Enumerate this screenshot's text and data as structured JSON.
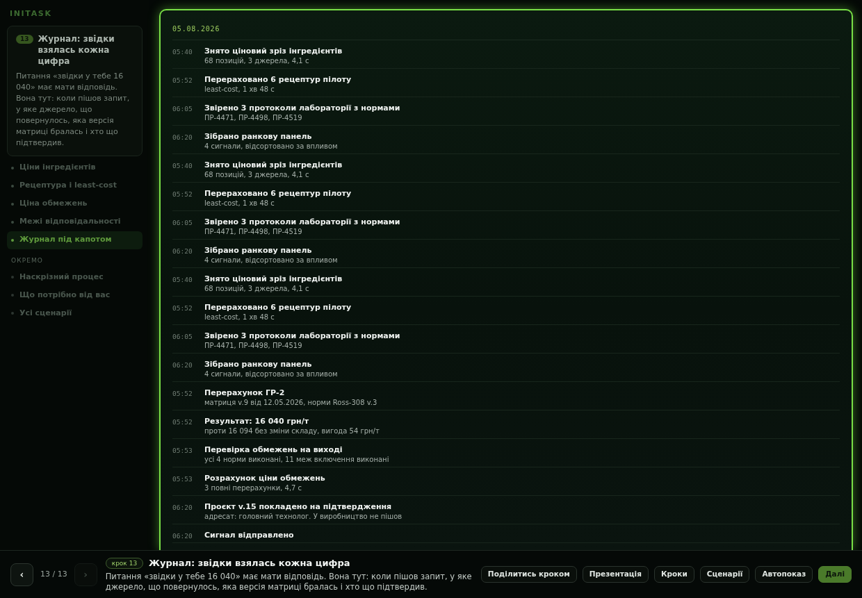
{
  "sidebar": {
    "logo": "INITASK",
    "items": [
      {
        "label": "Ціни інгредієнтів",
        "selected": false
      },
      {
        "label": "Рецептура і least-cost",
        "selected": false
      },
      {
        "label": "Ціна обмежень",
        "selected": false
      },
      {
        "label": "Межі відповідальності",
        "selected": false
      },
      {
        "label": "Журнал під капотом",
        "selected": true
      }
    ],
    "section": {
      "title": "ОКРЕМО",
      "items": [
        {
          "label": "Наскрізний процес",
          "selected": false
        },
        {
          "label": "Що потрібно від вас",
          "selected": false
        },
        {
          "label": "Усі сценарії",
          "selected": false
        }
      ]
    }
  },
  "step_card": {
    "badge": "13",
    "title": "Журнал: звідки взялась кожна цифра",
    "text": "Питання «звідки у тебе 16 040» має мати відповідь. Вона тут: коли пішов запит, у яке джерело, що повернулось, яка версія матриці бралась і хто що підтвердив."
  },
  "log": {
    "date": "05.08.2026",
    "entries": [
      {
        "time": "05:40",
        "title": "Знято ціновий зріз інгредієнтів",
        "detail": "68 позицій, 3 джерела, 4,1 с"
      },
      {
        "time": "05:52",
        "title": "Перераховано 6 рецептур пілоту",
        "detail": "least-cost, 1 хв 48 с"
      },
      {
        "time": "06:05",
        "title": "Звірено 3 протоколи лабораторії з нормами",
        "detail": "ПР-4471, ПР-4498, ПР-4519"
      },
      {
        "time": "06:20",
        "title": "Зібрано ранкову панель",
        "detail": "4 сигнали, відсортовано за впливом"
      },
      {
        "time": "05:40",
        "title": "Знято ціновий зріз інгредієнтів",
        "detail": "68 позицій, 3 джерела, 4,1 с"
      },
      {
        "time": "05:52",
        "title": "Перераховано 6 рецептур пілоту",
        "detail": "least-cost, 1 хв 48 с"
      },
      {
        "time": "06:05",
        "title": "Звірено 3 протоколи лабораторії з нормами",
        "detail": "ПР-4471, ПР-4498, ПР-4519"
      },
      {
        "time": "06:20",
        "title": "Зібрано ранкову панель",
        "detail": "4 сигнали, відсортовано за впливом"
      },
      {
        "time": "05:40",
        "title": "Знято ціновий зріз інгредієнтів",
        "detail": "68 позицій, 3 джерела, 4,1 с"
      },
      {
        "time": "05:52",
        "title": "Перераховано 6 рецептур пілоту",
        "detail": "least-cost, 1 хв 48 с"
      },
      {
        "time": "06:05",
        "title": "Звірено 3 протоколи лабораторії з нормами",
        "detail": "ПР-4471, ПР-4498, ПР-4519"
      },
      {
        "time": "06:20",
        "title": "Зібрано ранкову панель",
        "detail": "4 сигнали, відсортовано за впливом"
      },
      {
        "time": "05:52",
        "title": "Перерахунок ГР-2",
        "detail": "матриця v.9 від 12.05.2026, норми Ross-308 v.3"
      },
      {
        "time": "05:52",
        "title": "Результат: 16 040 грн/т",
        "detail": "проти 16 094 без зміни складу, вигода 54 грн/т"
      },
      {
        "time": "05:53",
        "title": "Перевірка обмежень на виході",
        "detail": "усі 4 норми виконані, 11 меж включення виконані"
      },
      {
        "time": "05:53",
        "title": "Розрахунок ціни обмежень",
        "detail": "3 повні перерахунки, 4,7 с"
      },
      {
        "time": "06:20",
        "title": "Проєкт v.15 покладено на підтвердження",
        "detail": "адресат: головний технолог. У виробництво не пішов"
      },
      {
        "time": "06:20",
        "title": "Сигнал відправлено"
      }
    ]
  },
  "footer": {
    "prev_button": {
      "label": "‹",
      "disabled": false
    },
    "counter": "13 / 13",
    "next_button": {
      "label": "›",
      "disabled": true
    },
    "step_badge": "крок 13",
    "title": "Журнал: звідки взялась кожна цифра",
    "text": "Питання «звідки у тебе 16 040» має мати відповідь. Вона тут: коли пішов запит, у яке джерело, що повернулось, яка версія матриці бралась і хто що підтвердив.",
    "buttons": [
      {
        "label": "Поділитись кроком",
        "kind": "outline"
      },
      {
        "label": "Презентація",
        "kind": "outline"
      },
      {
        "label": "Кроки",
        "kind": "outline"
      },
      {
        "label": "Сценарії",
        "kind": "outline"
      },
      {
        "label": "Автопоказ",
        "kind": "outline"
      },
      {
        "label": "Далі",
        "kind": "primary"
      }
    ]
  }
}
